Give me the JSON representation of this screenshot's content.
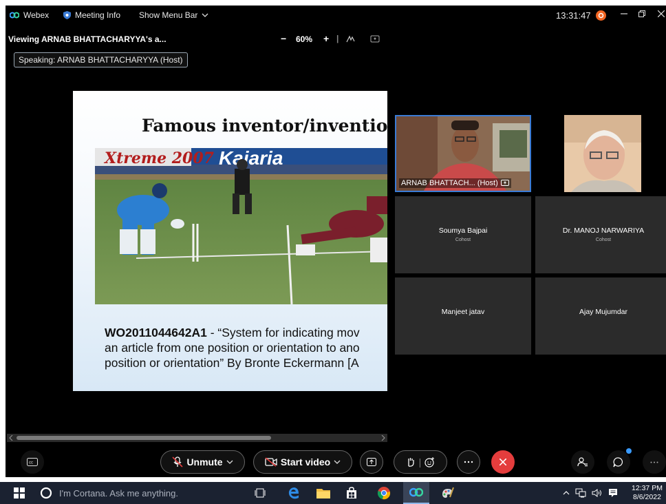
{
  "titlebar": {
    "app_name": "Webex",
    "meeting_info": "Meeting Info",
    "show_menu": "Show Menu Bar",
    "clock": "13:31:47"
  },
  "viewbar": {
    "title": "Viewing ARNAB BHATTACHARYYA's a...",
    "zoom": "60%",
    "minus": "−",
    "plus": "+"
  },
  "speaking": "Speaking: ARNAB BHATTACHARYYA (Host)",
  "slide": {
    "title": "Famous inventor/invention",
    "patent_id": "WO2011044642A1",
    "line1": " - “System for indicating mov",
    "line2": "an article from one position or orientation to ano",
    "line3": "position or orientation” By Bronte Eckermann [A",
    "banner_brand": "Kajaria",
    "banner_logo": "Xtreme 2007"
  },
  "participants": [
    {
      "name": "ARNAB BHATTACH... (Host)",
      "role": ""
    },
    {
      "name": "",
      "role": ""
    },
    {
      "name": "Soumya Bajpai",
      "role": "Cohost"
    },
    {
      "name": "Dr. MANOJ NARWARIYA",
      "role": "Cohost"
    },
    {
      "name": "Manjeet jatav",
      "role": ""
    },
    {
      "name": "Ajay Mujumdar",
      "role": ""
    }
  ],
  "controls": {
    "unmute": "Unmute",
    "start_video": "Start video"
  },
  "taskbar": {
    "cortana": "I'm Cortana. Ask me anything.",
    "time": "12:37 PM",
    "date": "8/6/2022"
  },
  "colors": {
    "accent_blue": "#3a7bd5",
    "end_red": "#e43d3d",
    "record_orange": "#f26522"
  }
}
